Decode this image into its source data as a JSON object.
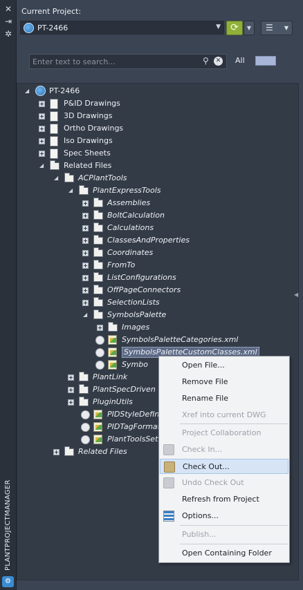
{
  "strip": {
    "title": "PLANTPROJECTMANAGER",
    "icons": [
      "close-icon",
      "auto-hide-icon",
      "settings-icon"
    ]
  },
  "header": {
    "current_project_label": "Current Project:",
    "project_value": "PT-2466",
    "search_placeholder": "Enter text to search...",
    "filter_label": "All"
  },
  "tree": [
    {
      "label": "PT-2466",
      "icon": "project-globe-icon",
      "state": "expanded",
      "italic": false
    },
    {
      "label": "P&ID Drawings",
      "icon": "pid-drawings-icon",
      "state": "collapsed",
      "italic": false
    },
    {
      "label": "3D Drawings",
      "icon": "3d-drawings-icon",
      "state": "collapsed",
      "italic": false
    },
    {
      "label": "Ortho Drawings",
      "icon": "ortho-drawings-icon",
      "state": "collapsed",
      "italic": false
    },
    {
      "label": "Iso Drawings",
      "icon": "iso-drawings-icon",
      "state": "collapsed",
      "italic": false
    },
    {
      "label": "Spec Sheets",
      "icon": "spec-sheets-icon",
      "state": "collapsed",
      "italic": false
    },
    {
      "label": "Related Files",
      "icon": "folder-icon",
      "state": "expanded",
      "italic": false
    },
    {
      "label": "ACPlantTools",
      "icon": "folder-icon",
      "state": "expanded",
      "italic": true
    },
    {
      "label": "PlantExpressTools",
      "icon": "folder-icon",
      "state": "expanded",
      "italic": true
    },
    {
      "label": "Assemblies",
      "icon": "folder-icon",
      "state": "collapsed",
      "italic": true
    },
    {
      "label": "BoltCalculation",
      "icon": "folder-icon",
      "state": "collapsed",
      "italic": true
    },
    {
      "label": "Calculations",
      "icon": "folder-icon",
      "state": "collapsed",
      "italic": true
    },
    {
      "label": "ClassesAndProperties",
      "icon": "folder-icon",
      "state": "collapsed",
      "italic": true
    },
    {
      "label": "Coordinates",
      "icon": "folder-icon",
      "state": "collapsed",
      "italic": true
    },
    {
      "label": "FromTo",
      "icon": "folder-icon",
      "state": "collapsed",
      "italic": true
    },
    {
      "label": "ListConfigurations",
      "icon": "folder-icon",
      "state": "collapsed",
      "italic": true
    },
    {
      "label": "OffPageConnectors",
      "icon": "folder-icon",
      "state": "collapsed",
      "italic": true
    },
    {
      "label": "SelectionLists",
      "icon": "folder-icon",
      "state": "collapsed",
      "italic": true
    },
    {
      "label": "SymbolsPalette",
      "icon": "folder-icon",
      "state": "expanded",
      "italic": true
    },
    {
      "label": "Images",
      "icon": "folder-icon",
      "state": "collapsed",
      "italic": true
    },
    {
      "label": "SymbolsPaletteCategories.xml",
      "icon": "xml-file-icon",
      "state": "file",
      "italic": true
    },
    {
      "label": "SymbolsPaletteCustomClasses.xml",
      "icon": "xml-file-icon",
      "state": "file",
      "italic": true,
      "selected": true
    },
    {
      "label": "Symbo",
      "icon": "xml-file-icon",
      "state": "file",
      "italic": true
    },
    {
      "label": "PlantLink",
      "icon": "folder-icon",
      "state": "collapsed",
      "italic": true
    },
    {
      "label": "PlantSpecDriven",
      "icon": "folder-icon",
      "state": "collapsed",
      "italic": true
    },
    {
      "label": "PluginUtils",
      "icon": "folder-icon",
      "state": "collapsed",
      "italic": true
    },
    {
      "label": "PIDStyleDefinit",
      "icon": "xml-file-icon",
      "state": "file",
      "italic": true
    },
    {
      "label": "PIDTagFormats",
      "icon": "xml-file-icon",
      "state": "file",
      "italic": true
    },
    {
      "label": "PlantToolsSetup",
      "icon": "xml-file-icon",
      "state": "file",
      "italic": true
    },
    {
      "label": "Related Files",
      "icon": "folder-icon",
      "state": "collapsed",
      "italic": true
    }
  ],
  "context_menu": {
    "items": [
      {
        "label": "Open File...",
        "enabled": true,
        "icon": ""
      },
      {
        "label": "Remove File",
        "enabled": true,
        "icon": ""
      },
      {
        "label": "Rename File",
        "enabled": true,
        "icon": ""
      },
      {
        "label": "Xref into current DWG",
        "enabled": false,
        "icon": ""
      },
      {
        "label": "Project Collaboration",
        "enabled": false,
        "icon": ""
      },
      {
        "label": "Check In...",
        "enabled": false,
        "icon": "check-in-icon"
      },
      {
        "label": "Check Out...",
        "enabled": true,
        "icon": "check-out-icon",
        "highlighted": true
      },
      {
        "label": "Undo Check Out",
        "enabled": false,
        "icon": "undo-check-out-icon"
      },
      {
        "label": "Refresh from Project",
        "enabled": true,
        "icon": ""
      },
      {
        "label": "Options...",
        "enabled": true,
        "icon": "options-icon"
      },
      {
        "label": "Publish...",
        "enabled": false,
        "icon": ""
      },
      {
        "label": "Open Containing Folder",
        "enabled": true,
        "icon": ""
      }
    ]
  },
  "colors": {
    "panel_bg": "#3b4453",
    "tree_bg": "#333b47",
    "refresh_green": "#8fb03a",
    "menu_highlight": "#d6e4f5",
    "selection": "#5c6a86"
  }
}
